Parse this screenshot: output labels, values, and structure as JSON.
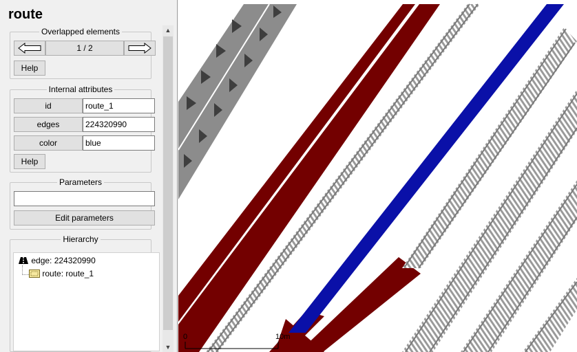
{
  "header": {
    "title": "route"
  },
  "overlapped": {
    "legend": "Overlapped elements",
    "counter": "1 / 2",
    "help_label": "Help"
  },
  "attributes": {
    "legend": "Internal attributes",
    "rows": [
      {
        "label": "id",
        "value": "route_1"
      },
      {
        "label": "edges",
        "value": "224320990"
      },
      {
        "label": "color",
        "value": "blue"
      }
    ],
    "help_label": "Help"
  },
  "parameters": {
    "legend": "Parameters",
    "value": "",
    "edit_label": "Edit parameters"
  },
  "hierarchy": {
    "legend": "Hierarchy",
    "items": [
      {
        "label": "edge: 224320990",
        "icon": "edge-icon"
      },
      {
        "label": "route: route_1",
        "icon": "route-icon"
      }
    ]
  },
  "view": {
    "scale_start": "0",
    "scale_end": "10m",
    "colors": {
      "route": "#0a10a8",
      "edge": "#730000",
      "road": "#808080",
      "rail": "#a8a8a8"
    }
  }
}
